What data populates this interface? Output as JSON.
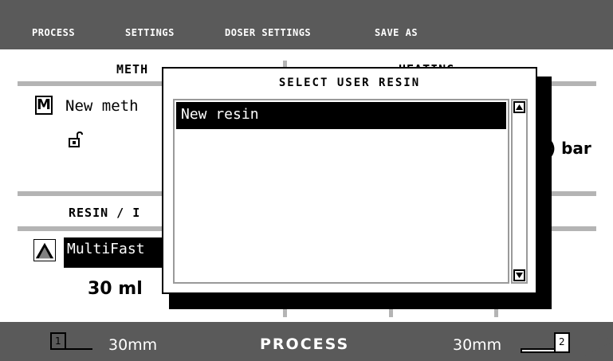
{
  "menu": {
    "items": [
      "PROCESS",
      "SETTINGS",
      "DOSER SETTINGS",
      "SAVE AS"
    ]
  },
  "method": {
    "header": "METH",
    "icon_letter": "M",
    "name": "New meth"
  },
  "heating": {
    "header": "HEATING",
    "pressure": ") bar"
  },
  "resin": {
    "header": "RESIN / I",
    "name": "MultiFast",
    "volume": "30 ml"
  },
  "dialog": {
    "title": "SELECT USER RESIN",
    "items": [
      "New resin"
    ],
    "selected_index": 0
  },
  "status_bar": {
    "left_value": "30mm",
    "title": "PROCESS",
    "right_value": "30mm",
    "left_marker": "1",
    "right_marker": "2"
  },
  "colors": {
    "bar": "#5a5a5a",
    "divider": "#b4b4b4",
    "selection": "#000000"
  }
}
